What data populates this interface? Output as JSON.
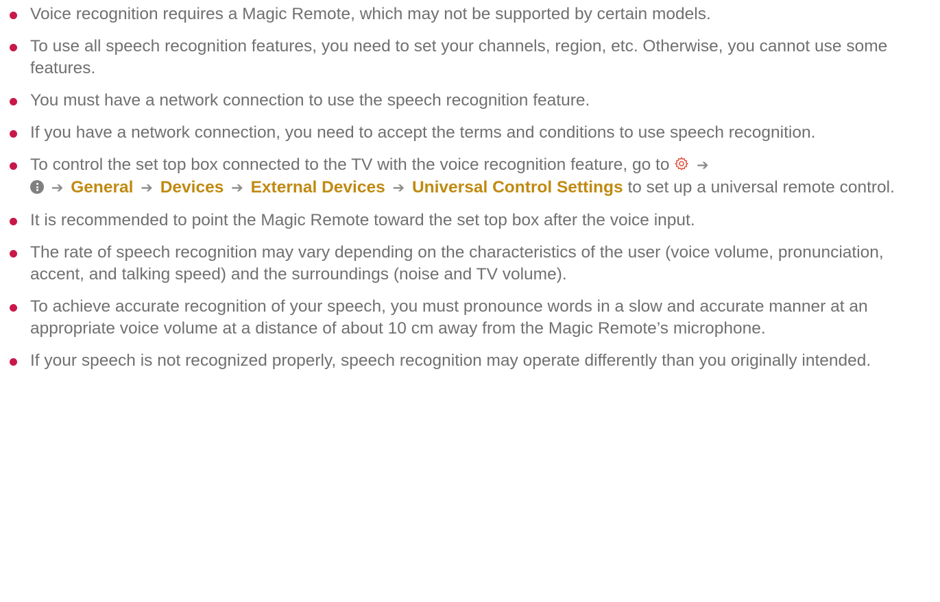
{
  "notes": [
    "Voice recognition requires a Magic Remote, which may not be supported by certain models.",
    "To use all speech recognition features, you need to set your channels, region, etc. Otherwise, you cannot use some features.",
    "You must have a network connection to use the speech recognition feature.",
    "If you have a network connection, you need to accept the terms and conditions to use speech recognition.",
    {
      "intro": "To control the set top box connected to the TV with the voice recognition feature, go to",
      "path": [
        "General",
        "Devices",
        "External Devices",
        "Universal Control Settings"
      ],
      "outro": "to set up a universal remote control.",
      "icons": [
        "settings-gear-icon",
        "more-menu-icon"
      ]
    },
    "It is recommended to point the Magic Remote toward the set top box after the voice input.",
    "The rate of speech recognition may vary depending on the characteristics of the user (voice volume, pronunciation, accent, and talking speed) and the surroundings (noise and TV volume).",
    "To achieve accurate recognition of your speech, you must pronounce words in a slow and accurate manner at an appropriate voice volume at a distance of about 10 cm away from the Magic Remote’s microphone.",
    "If your speech is not recognized properly, speech recognition may operate differently than you originally intended."
  ],
  "colors": {
    "text": "#707070",
    "bullet": "#c8184a",
    "highlight": "#c08a12",
    "arrow": "#8c8c8c",
    "gear_icon": "#e0503a"
  }
}
